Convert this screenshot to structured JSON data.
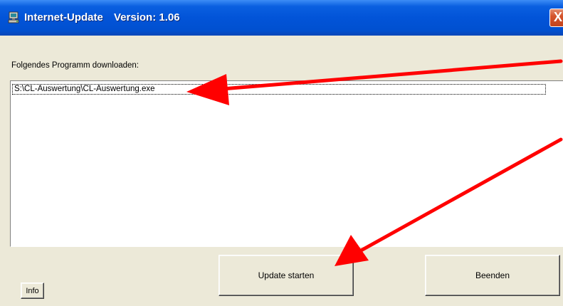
{
  "window": {
    "title": "Internet-Update",
    "version": "Version: 1.06",
    "close_glyph": "X"
  },
  "main": {
    "label": "Folgendes Programm downloaden:",
    "list_items": [
      "S:\\CL-Auswertung\\CL-Auswertung.exe"
    ]
  },
  "buttons": {
    "update_label": "Update starten",
    "beenden_label": "Beenden",
    "info_label": "Info"
  },
  "annotations": {
    "arrow_color": "#ff0000"
  },
  "icons": {
    "app": "network-computer-icon",
    "close": "close-icon"
  }
}
